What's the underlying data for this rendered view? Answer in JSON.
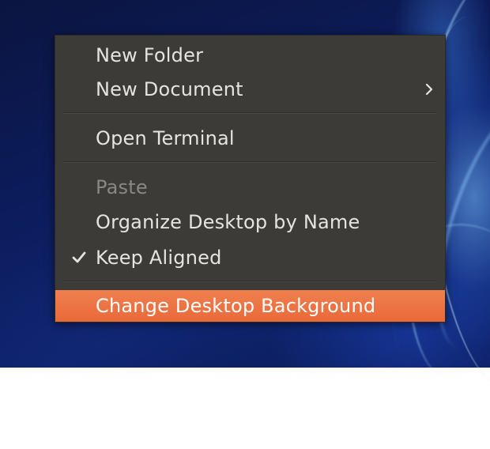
{
  "menu": {
    "items": [
      {
        "label": "New Folder"
      },
      {
        "label": "New Document",
        "submenu_icon": "chevron-right-icon"
      },
      {
        "label": "Open Terminal"
      },
      {
        "label": "Paste",
        "state": "disabled"
      },
      {
        "label": "Organize Desktop by Name"
      },
      {
        "label": "Keep Aligned",
        "checked": true,
        "check_icon": "checkmark-icon"
      },
      {
        "label": "Change Desktop Background",
        "state": "highlighted"
      }
    ]
  },
  "colors": {
    "menu_background": "#3c3b37",
    "highlight": "#e9693a",
    "text": "#e6e4df",
    "disabled_text": "#8a8882"
  }
}
